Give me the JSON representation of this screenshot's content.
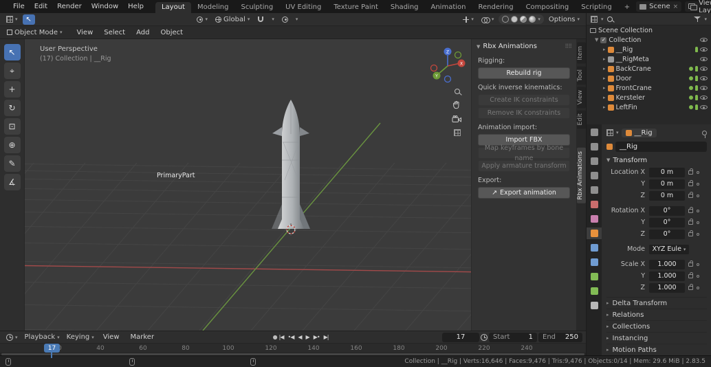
{
  "glyphs": {
    "chevron_down": "▾",
    "caret_right": "▸",
    "caret_down": "▼",
    "close": "×",
    "check": "✓",
    "plus": "+",
    "grip": "⠿⠿",
    "record": "●",
    "export": "↗",
    "transport": [
      "|◀",
      "•◀",
      "◀",
      "▶",
      "▶•",
      "▶|"
    ]
  },
  "topbar": {
    "menus": [
      "File",
      "Edit",
      "Render",
      "Window",
      "Help"
    ],
    "workspaces": [
      "Layout",
      "Modeling",
      "Sculpting",
      "UV Editing",
      "Texture Paint",
      "Shading",
      "Animation",
      "Rendering",
      "Compositing",
      "Scripting"
    ],
    "add_tab": "+",
    "scene_label": "Scene",
    "view_layer_label": "View Layer"
  },
  "viewport_header": {
    "orientation": "Global",
    "options_label": "Options"
  },
  "tool_bar": {
    "mode": "Object Mode",
    "menus": [
      "View",
      "Select",
      "Add",
      "Object"
    ]
  },
  "toolbar": {
    "tools": [
      {
        "name": "select-box",
        "glyph": "↖"
      },
      {
        "name": "cursor",
        "glyph": "⌖"
      },
      {
        "name": "move",
        "glyph": "+"
      },
      {
        "name": "rotate",
        "glyph": "↻"
      },
      {
        "name": "scale",
        "glyph": "⊡"
      },
      {
        "name": "transform",
        "glyph": "⊕"
      },
      {
        "name": "annotate",
        "glyph": "✎"
      },
      {
        "name": "measure",
        "glyph": "∡"
      }
    ]
  },
  "viewport": {
    "perspective_label": "User Perspective",
    "collection_label": "(17) Collection | __Rig",
    "bone_label": "PrimaryPart",
    "axis_x": "X",
    "axis_y": "Y",
    "axis_z": "Z"
  },
  "npanel": {
    "title": "Rbx Animations",
    "rigging_label": "Rigging:",
    "rebuild_button": "Rebuild rig",
    "ik_label": "Quick inverse kinematics:",
    "create_ik_button": "Create IK constraints",
    "remove_ik_button": "Remove IK constraints",
    "import_label": "Animation import:",
    "import_fbx_button": "Import FBX",
    "map_keyframes_button": "Map keyframes by bone name",
    "apply_armature_button": "Apply armature transform",
    "export_label": "Export:",
    "export_button": "Export animation",
    "tabs": [
      "Item",
      "Tool",
      "View",
      "Edit"
    ],
    "active_tab": "Rbx Animations"
  },
  "outliner": {
    "scene_collection": "Scene Collection",
    "collection": "Collection",
    "items": [
      {
        "name": "__Rig"
      },
      {
        "name": "__RigMeta"
      },
      {
        "name": "BackCrane"
      },
      {
        "name": "Door"
      },
      {
        "name": "FrontCrane"
      },
      {
        "name": "Kersteler"
      },
      {
        "name": "LeftFin"
      }
    ]
  },
  "properties": {
    "breadcrumb_object": "__Rig",
    "object_name": "__Rig",
    "transform_title": "Transform",
    "rows": [
      {
        "label": "Location X",
        "value": "0 m"
      },
      {
        "label": "Y",
        "value": "0 m"
      },
      {
        "label": "Z",
        "value": "0 m"
      },
      {
        "label": "Rotation X",
        "value": "0°"
      },
      {
        "label": "Y",
        "value": "0°"
      },
      {
        "label": "Z",
        "value": "0°"
      },
      {
        "label": "Scale X",
        "value": "1.000"
      },
      {
        "label": "Y",
        "value": "1.000"
      },
      {
        "label": "Z",
        "value": "1.000"
      }
    ],
    "mode_label": "Mode",
    "mode_value": "XYZ Eule",
    "sections": [
      "Delta Transform",
      "Relations",
      "Collections",
      "Instancing",
      "Motion Paths"
    ]
  },
  "timeline": {
    "menus": [
      "Playback",
      "Keying",
      "View",
      "Marker"
    ],
    "current_frame": "17",
    "start_label": "Start",
    "start_value": "1",
    "end_label": "End",
    "end_value": "250",
    "ticks": [
      "20",
      "40",
      "60",
      "80",
      "100",
      "120",
      "140",
      "160",
      "180",
      "200",
      "220",
      "240"
    ],
    "playhead": "17"
  },
  "statusbar": {
    "info": "Collection | __Rig | Verts:16,646 | Faces:9,476 | Tris:9,476 | Objects:0/14 | Mem: 29.6 MiB | 2.83.5"
  }
}
